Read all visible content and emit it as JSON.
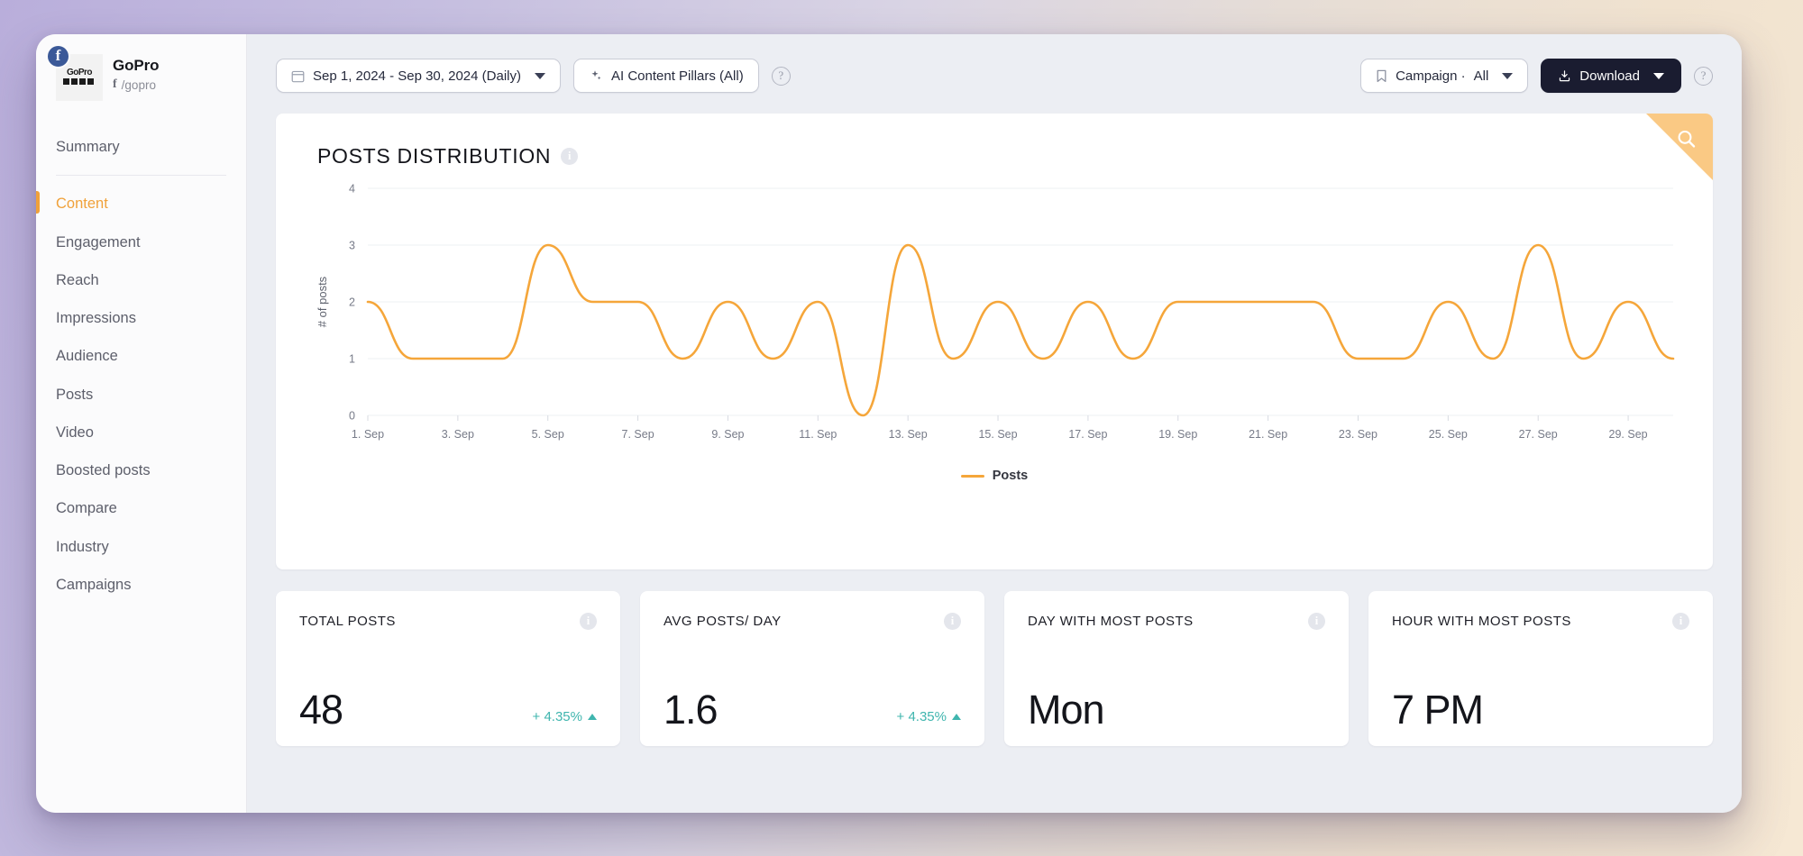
{
  "profile": {
    "name": "GoPro",
    "handle": "/gopro",
    "network_glyph": "f",
    "badge_glyph": "f",
    "logo_text": "GoPro"
  },
  "sidebar": {
    "items": [
      {
        "label": "Summary",
        "active": false
      },
      {
        "label": "Content",
        "active": true
      },
      {
        "label": "Engagement",
        "active": false
      },
      {
        "label": "Reach",
        "active": false
      },
      {
        "label": "Impressions",
        "active": false
      },
      {
        "label": "Audience",
        "active": false
      },
      {
        "label": "Posts",
        "active": false
      },
      {
        "label": "Video",
        "active": false
      },
      {
        "label": "Boosted posts",
        "active": false
      },
      {
        "label": "Compare",
        "active": false
      },
      {
        "label": "Industry",
        "active": false
      },
      {
        "label": "Campaigns",
        "active": false
      }
    ]
  },
  "toolbar": {
    "date_range": "Sep 1, 2024 - Sep 30, 2024 (Daily)",
    "date_icon": "calendar-icon",
    "ai_pillars": "AI Content Pillars (All)",
    "ai_icon": "sparkle-icon",
    "help_glyph": "?",
    "campaign_label": "Campaign ·",
    "campaign_value": "All",
    "campaign_icon": "bookmark-icon",
    "download_label": "Download",
    "download_icon": "download-icon"
  },
  "chart_card": {
    "title": "POSTS DISTRIBUTION",
    "info_glyph": "i",
    "corner_icon": "search-icon",
    "corner_color": "#fac984"
  },
  "chart_data": {
    "type": "line",
    "title": "POSTS DISTRIBUTION",
    "xlabel": "",
    "ylabel": "# of posts",
    "ylim": [
      0,
      4
    ],
    "yticks": [
      0,
      1,
      2,
      3,
      4
    ],
    "grid": true,
    "legend_position": "bottom",
    "line_color": "#f5a63a",
    "x": [
      "1. Sep",
      "2. Sep",
      "3. Sep",
      "4. Sep",
      "5. Sep",
      "6. Sep",
      "7. Sep",
      "8. Sep",
      "9. Sep",
      "10. Sep",
      "11. Sep",
      "12. Sep",
      "13. Sep",
      "14. Sep",
      "15. Sep",
      "16. Sep",
      "17. Sep",
      "18. Sep",
      "19. Sep",
      "20. Sep",
      "21. Sep",
      "22. Sep",
      "23. Sep",
      "24. Sep",
      "25. Sep",
      "26. Sep",
      "27. Sep",
      "28. Sep",
      "29. Sep",
      "30. Sep"
    ],
    "xtick_labels": [
      "1. Sep",
      "3. Sep",
      "5. Sep",
      "7. Sep",
      "9. Sep",
      "11. Sep",
      "13. Sep",
      "15. Sep",
      "17. Sep",
      "19. Sep",
      "21. Sep",
      "23. Sep",
      "25. Sep",
      "27. Sep",
      "29. Sep"
    ],
    "series": [
      {
        "name": "Posts",
        "color": "#f5a63a",
        "values": [
          2,
          1,
          1,
          1,
          3,
          2,
          2,
          1,
          2,
          1,
          2,
          0,
          3,
          1,
          2,
          1,
          2,
          1,
          2,
          2,
          2,
          2,
          1,
          1,
          2,
          1,
          3,
          1,
          2,
          1
        ]
      }
    ]
  },
  "kpis": [
    {
      "label": "TOTAL POSTS",
      "value": "48",
      "delta": "+ 4.35%",
      "delta_direction": "up",
      "delta_color": "#3fb5ae",
      "info_glyph": "i"
    },
    {
      "label": "AVG POSTS/ DAY",
      "value": "1.6",
      "delta": "+ 4.35%",
      "delta_direction": "up",
      "delta_color": "#3fb5ae",
      "info_glyph": "i"
    },
    {
      "label": "DAY WITH MOST POSTS",
      "value": "Mon",
      "delta": "",
      "delta_direction": "",
      "delta_color": "",
      "info_glyph": "i"
    },
    {
      "label": "HOUR WITH MOST POSTS",
      "value": "7 PM",
      "delta": "",
      "delta_direction": "",
      "delta_color": "",
      "info_glyph": "i"
    }
  ]
}
